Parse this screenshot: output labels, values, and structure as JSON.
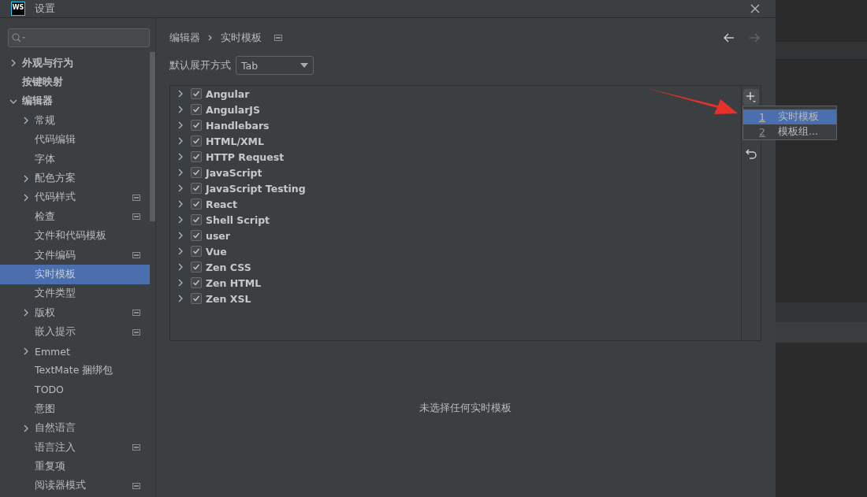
{
  "window": {
    "app_icon_text": "WS",
    "title": "设置"
  },
  "sidebar": {
    "items": [
      {
        "label": "外观与行为",
        "expanded": false,
        "selected": false,
        "project_scope": false
      },
      {
        "label": "按键映射",
        "selected": false,
        "project_scope": false
      },
      {
        "label": "编辑器",
        "expanded": true,
        "selected": false,
        "project_scope": false,
        "children": [
          {
            "label": "常规",
            "expanded": false,
            "selected": false,
            "project_scope": false
          },
          {
            "label": "代码编辑",
            "selected": false,
            "project_scope": false
          },
          {
            "label": "字体",
            "selected": false,
            "project_scope": false
          },
          {
            "label": "配色方案",
            "expanded": false,
            "selected": false,
            "project_scope": false
          },
          {
            "label": "代码样式",
            "expanded": false,
            "selected": false,
            "project_scope": true
          },
          {
            "label": "检查",
            "selected": false,
            "project_scope": true
          },
          {
            "label": "文件和代码模板",
            "selected": false,
            "project_scope": false
          },
          {
            "label": "文件编码",
            "selected": false,
            "project_scope": true
          },
          {
            "label": "实时模板",
            "selected": true,
            "project_scope": false
          },
          {
            "label": "文件类型",
            "selected": false,
            "project_scope": false
          },
          {
            "label": "版权",
            "expanded": false,
            "selected": false,
            "project_scope": true
          },
          {
            "label": "嵌入提示",
            "selected": false,
            "project_scope": true
          },
          {
            "label": "Emmet",
            "expanded": false,
            "selected": false,
            "project_scope": false
          },
          {
            "label": "TextMate 捆绑包",
            "selected": false,
            "project_scope": false
          },
          {
            "label": "TODO",
            "selected": false,
            "project_scope": false
          },
          {
            "label": "意图",
            "selected": false,
            "project_scope": false
          },
          {
            "label": "自然语言",
            "expanded": false,
            "selected": false,
            "project_scope": false
          },
          {
            "label": "语言注入",
            "selected": false,
            "project_scope": true
          },
          {
            "label": "重复项",
            "selected": false,
            "project_scope": false
          },
          {
            "label": "阅读器模式",
            "selected": false,
            "project_scope": true
          }
        ]
      }
    ]
  },
  "breadcrumb": {
    "items": [
      "编辑器",
      "实时模板"
    ],
    "project_scope": true
  },
  "expand_with": {
    "label": "默认展开方式",
    "value": "Tab"
  },
  "template_groups": [
    {
      "label": "Angular",
      "checked": true,
      "expanded": false
    },
    {
      "label": "AngularJS",
      "checked": true,
      "expanded": false
    },
    {
      "label": "Handlebars",
      "checked": true,
      "expanded": false
    },
    {
      "label": "HTML/XML",
      "checked": true,
      "expanded": false
    },
    {
      "label": "HTTP Request",
      "checked": true,
      "expanded": false
    },
    {
      "label": "JavaScript",
      "checked": true,
      "expanded": false
    },
    {
      "label": "JavaScript Testing",
      "checked": true,
      "expanded": false
    },
    {
      "label": "React",
      "checked": true,
      "expanded": false
    },
    {
      "label": "Shell Script",
      "checked": true,
      "expanded": false
    },
    {
      "label": "user",
      "checked": true,
      "expanded": false
    },
    {
      "label": "Vue",
      "checked": true,
      "expanded": false
    },
    {
      "label": "Zen CSS",
      "checked": true,
      "expanded": false
    },
    {
      "label": "Zen HTML",
      "checked": true,
      "expanded": false
    },
    {
      "label": "Zen XSL",
      "checked": true,
      "expanded": false
    }
  ],
  "add_menu": [
    {
      "mnemonic": "1",
      "label": "实时模板",
      "selected": true
    },
    {
      "mnemonic": "2",
      "label": "模板组...",
      "selected": false
    }
  ],
  "empty_message": "未选择任何实时模板"
}
